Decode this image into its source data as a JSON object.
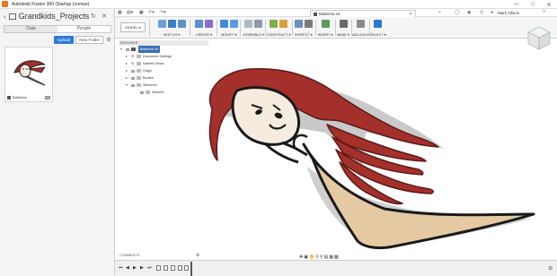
{
  "window": {
    "title": "Autodesk Fusion 360 (Startup License)",
    "controls": [
      "—",
      "□",
      "✕"
    ]
  },
  "data_panel": {
    "project_name": "Grandkids_Projects",
    "tabs": [
      "Data",
      "People"
    ],
    "upload_label": "Upload",
    "new_folder_label": "New Folder",
    "files": [
      {
        "name": "Ballerina",
        "version": "V4"
      }
    ]
  },
  "app_bar": {
    "document_tab": "Ballerina v4",
    "user_name": "Mark Allison"
  },
  "toolbar": {
    "workspace": "MODEL",
    "groups": [
      {
        "label": "SKETCH ▾",
        "colors": [
          "#6aa0d8",
          "#3a7fc1",
          "#5d8fc8"
        ]
      },
      {
        "label": "CREATE ▾",
        "colors": [
          "#5a8fd0",
          "#8a6cc9"
        ]
      },
      {
        "label": "MODIFY ▾",
        "colors": [
          "#3f8ad6",
          "#5a9be0"
        ]
      },
      {
        "label": "ASSEMBLE ▾",
        "colors": [
          "#b0b8c4",
          "#8f9aa8"
        ]
      },
      {
        "label": "CONSTRUCT ▾",
        "colors": [
          "#7fae4d",
          "#d8a23a"
        ]
      },
      {
        "label": "INSPECT ▾",
        "colors": [
          "#6a8fc0",
          "#7a7a7a"
        ]
      },
      {
        "label": "INSERT ▾",
        "colors": [
          "#5a9b5a"
        ]
      },
      {
        "label": "MAKE ▾",
        "colors": [
          "#6a6a6a"
        ]
      },
      {
        "label": "ADD-INS ▾",
        "colors": [
          "#8a8a8a"
        ]
      },
      {
        "label": "SELECT ▾",
        "colors": [
          "#2a7ad0"
        ]
      }
    ]
  },
  "browser": {
    "header": "BROWSER",
    "root": "Ballerina v4",
    "nodes": [
      {
        "label": "Document Settings"
      },
      {
        "label": "Named Views"
      },
      {
        "label": "Origin"
      },
      {
        "label": "Bodies"
      },
      {
        "label": "Sketches"
      },
      {
        "label": "Sketch1"
      }
    ]
  },
  "comments": {
    "label": "COMMENTS"
  },
  "colors": {
    "hair": "#a4302c",
    "dress": "#e5c9a2",
    "face": "#f5ecdf",
    "outline": "#1a1a1a",
    "accent": "#2b7bd4"
  }
}
